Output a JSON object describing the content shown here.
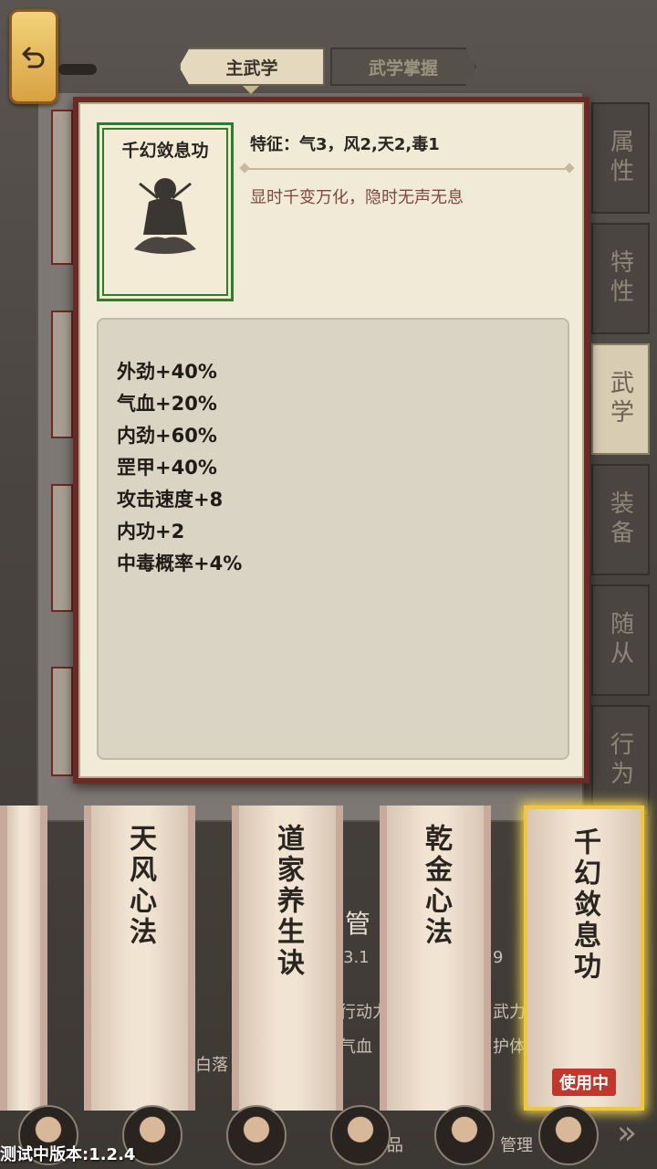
{
  "tabs": {
    "main": "主武学",
    "mastery": "武学掌握"
  },
  "side_tabs": [
    "属性",
    "特性",
    "武学",
    "装备",
    "随从",
    "行为"
  ],
  "active_side_tab": 2,
  "popup": {
    "skill_name": "千幻敛息功",
    "feature": "特征：气3，风2,天2,毒1",
    "description": "显时千变万化，隐时无声无息",
    "stats": [
      "外劲+40%",
      "气血+20%",
      "内劲+60%",
      "罡甲+40%",
      "攻击速度+8",
      "内功+2",
      "中毒概率+4%"
    ]
  },
  "scrolls": [
    {
      "name": ""
    },
    {
      "name": "天风心法"
    },
    {
      "name": "道家养生诀"
    },
    {
      "name": "乾金心法"
    },
    {
      "name": "千幻敛息功",
      "badge": "使用中",
      "selected": true
    }
  ],
  "background_fragments": {
    "manage": "管",
    "num1": "3.1",
    "num2": "9",
    "action": "行动力",
    "martial": "武力",
    "hp": "气血",
    "guard": "护体",
    "name": "白落",
    "goods": "品",
    "manage2": "管理"
  },
  "version": "测试中版本:1.2.4",
  "colors": {
    "accent": "#2f7d2c",
    "badge": "#c2372c",
    "popup_border": "#6b2a26"
  }
}
